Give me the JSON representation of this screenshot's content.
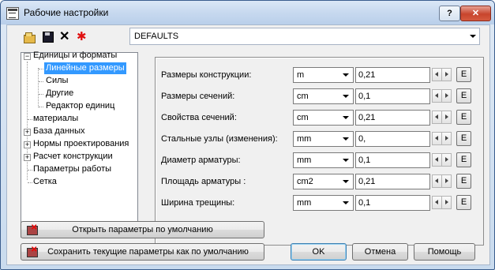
{
  "window": {
    "title": "Рабочие настройки",
    "help_label": "?",
    "close_label": "✕"
  },
  "toolbar": {
    "icons": [
      "open-folder-icon",
      "save-disk-icon",
      "delete-x-icon",
      "new-star-icon"
    ],
    "delete_glyph": "✕",
    "star_glyph": "✱"
  },
  "preset": {
    "value": "DEFAULTS"
  },
  "tree": {
    "expander_plus": "+",
    "expander_minus": "−",
    "items": [
      {
        "label": "Единицы и форматы",
        "expanded": true
      },
      {
        "label": "Линейные размеры",
        "selected": true
      },
      {
        "label": "Силы"
      },
      {
        "label": "Другие"
      },
      {
        "label": "Редактор единиц"
      },
      {
        "label": "материалы"
      },
      {
        "label": "База данных"
      },
      {
        "label": "Нормы проектирования"
      },
      {
        "label": "Расчет конструкции"
      },
      {
        "label": "Параметры работы"
      },
      {
        "label": "Сетка"
      }
    ]
  },
  "units": {
    "edit_label": "E",
    "rows": [
      {
        "label": "Размеры конструкции:",
        "unit": "m",
        "value": "0,21"
      },
      {
        "label": "Размеры сечений:",
        "unit": "cm",
        "value": "0,1"
      },
      {
        "label": "Свойства сечений:",
        "unit": "cm",
        "value": "0,21"
      },
      {
        "label": "Стальные узлы (изменения):",
        "unit": "mm",
        "value": "0,"
      },
      {
        "label": "Диаметр арматуры:",
        "unit": "mm",
        "value": "0,1"
      },
      {
        "label": "Площадь арматуры :",
        "unit": "cm2",
        "value": "0,21"
      },
      {
        "label": "Ширина трещины:",
        "unit": "mm",
        "value": "0,1"
      }
    ]
  },
  "buttons": {
    "open_defaults": "Открыть параметры по умолчанию",
    "save_defaults": "Сохранить текущие параметры как по умолчанию",
    "ok": "OK",
    "cancel": "Отмена",
    "help": "Помощь"
  }
}
